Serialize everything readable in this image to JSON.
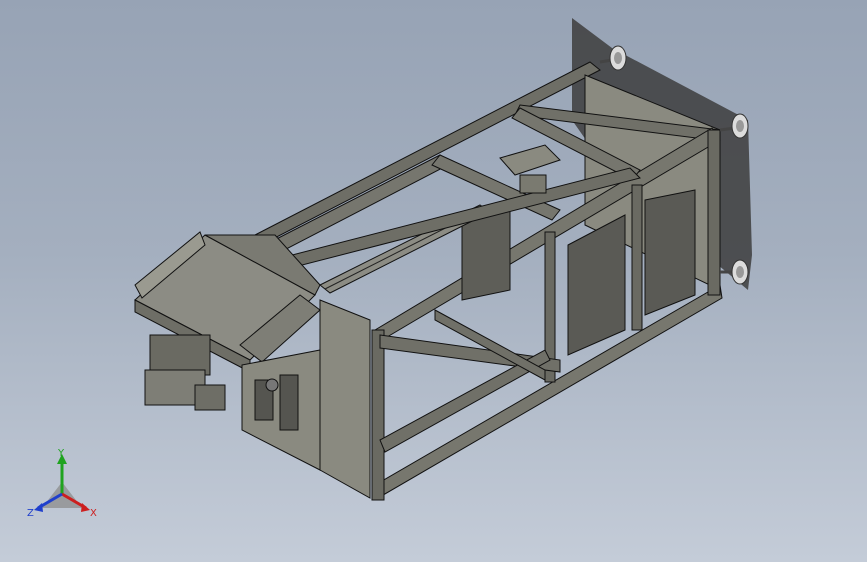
{
  "triad": {
    "x_label": "X",
    "y_label": "Y",
    "z_label": "Z"
  },
  "colors": {
    "frame": "#7a7a70",
    "frame_dark": "#4a4a44",
    "outline": "#1a1a1a",
    "x_axis": "#cc1f1f",
    "y_axis": "#1fa31f",
    "z_axis": "#1f3fcc"
  }
}
